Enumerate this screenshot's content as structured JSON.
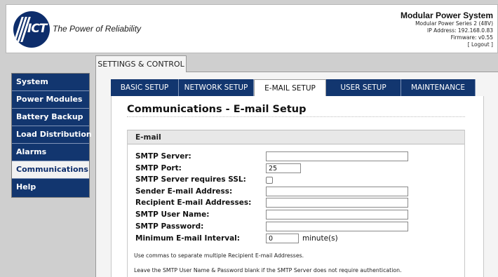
{
  "header": {
    "brand": {
      "logo_text": "ICT",
      "tagline": "The Power of Reliability"
    },
    "system": {
      "title": "Modular Power System",
      "model": "Modular Power Series 2 (48V)",
      "ip": "IP Address: 192.168.0.83",
      "firmware": "Firmware: v0.55",
      "logout": "[ Logout ]"
    }
  },
  "panel_tab": "SETTINGS & CONTROL",
  "sidebar": {
    "items": [
      {
        "label": "System"
      },
      {
        "label": "Power Modules"
      },
      {
        "label": "Battery Backup"
      },
      {
        "label": "Load Distribution"
      },
      {
        "label": "Alarms"
      },
      {
        "label": "Communications",
        "active": true
      },
      {
        "label": "Help"
      }
    ]
  },
  "subtabs": [
    {
      "label": "BASIC SETUP"
    },
    {
      "label": "NETWORK SETUP"
    },
    {
      "label": "E-MAIL SETUP",
      "active": true
    },
    {
      "label": "USER SETUP"
    },
    {
      "label": "MAINTENANCE"
    }
  ],
  "page": {
    "title": "Communications - E-mail Setup",
    "section_title": "E-mail",
    "fields": {
      "smtp_server": {
        "label": "SMTP Server:",
        "value": ""
      },
      "smtp_port": {
        "label": "SMTP Port:",
        "value": "25"
      },
      "smtp_ssl": {
        "label": "SMTP Server requires SSL:",
        "checked": false
      },
      "sender": {
        "label": "Sender E-mail Address:",
        "value": ""
      },
      "recipients": {
        "label": "Recipient E-mail Addresses:",
        "value": ""
      },
      "user_name": {
        "label": "SMTP User Name:",
        "value": ""
      },
      "password": {
        "label": "SMTP Password:",
        "value": ""
      },
      "interval": {
        "label": "Minimum E-mail Interval:",
        "value": "0",
        "unit": "minute(s)"
      }
    },
    "notes": [
      "Use commas to separate multiple Recipient E-mail Addresses.",
      "Leave the SMTP User Name & Password blank if the SMTP Server does not require authentication."
    ]
  },
  "colors": {
    "nav_blue": "#12366f",
    "panel_gray": "#f4f4f4",
    "section_gray": "#e8e8e8"
  }
}
